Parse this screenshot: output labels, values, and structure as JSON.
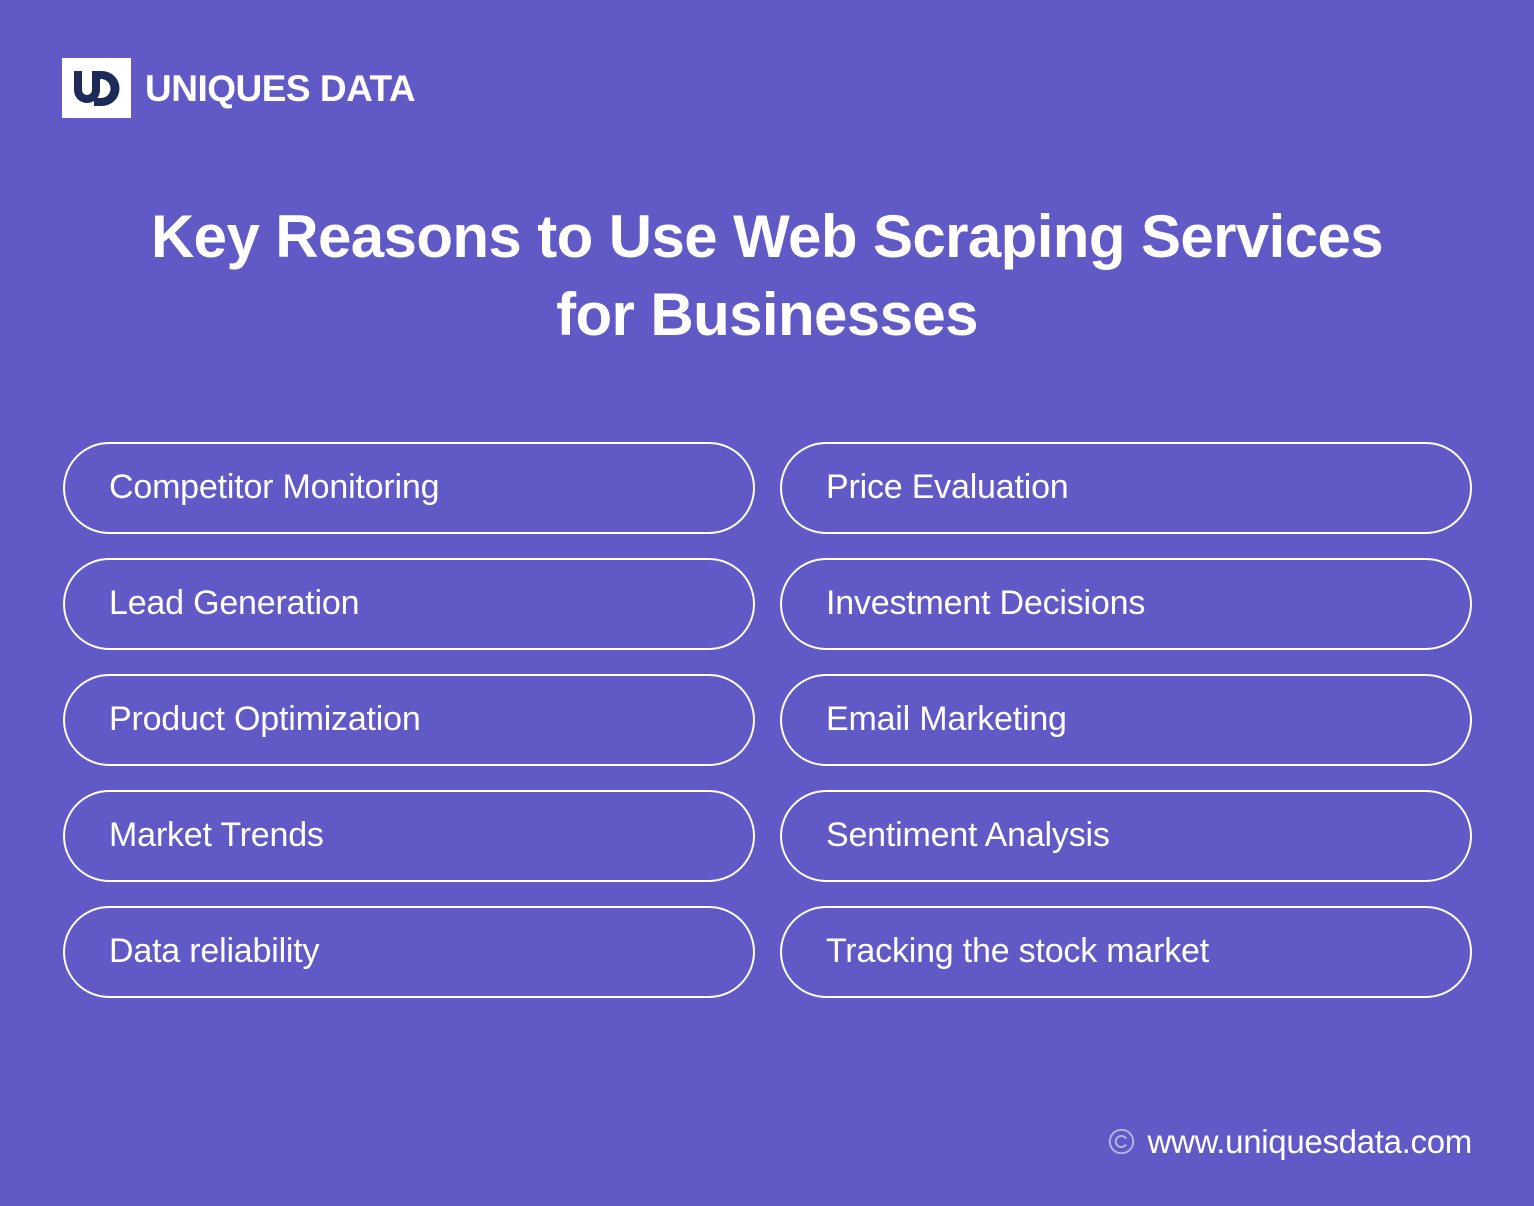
{
  "theme": {
    "background": "#6159c6",
    "foreground": "#ffffff",
    "logo_mark_bg": "#ffffff",
    "logo_mark_fg": "#1e2a5a"
  },
  "brand": {
    "logo_icon": "ud-monogram-icon",
    "name": "UNIQUES DATA"
  },
  "headline": {
    "line1": "Key Reasons to Use Web Scraping Services",
    "line2": "for Businesses",
    "full": "Key Reasons to Use Web Scraping Services for Businesses"
  },
  "reasons": {
    "left_column": [
      {
        "label": "Competitor Monitoring"
      },
      {
        "label": "Lead Generation"
      },
      {
        "label": "Product Optimization"
      },
      {
        "label": "Market Trends"
      },
      {
        "label": "Data reliability"
      }
    ],
    "right_column": [
      {
        "label": "Price Evaluation"
      },
      {
        "label": "Investment Decisions"
      },
      {
        "label": "Email Marketing"
      },
      {
        "label": "Sentiment Analysis"
      },
      {
        "label": "Tracking the stock market"
      }
    ]
  },
  "footer": {
    "copyright_icon": "copyright-icon",
    "url": "www.uniquesdata.com"
  }
}
